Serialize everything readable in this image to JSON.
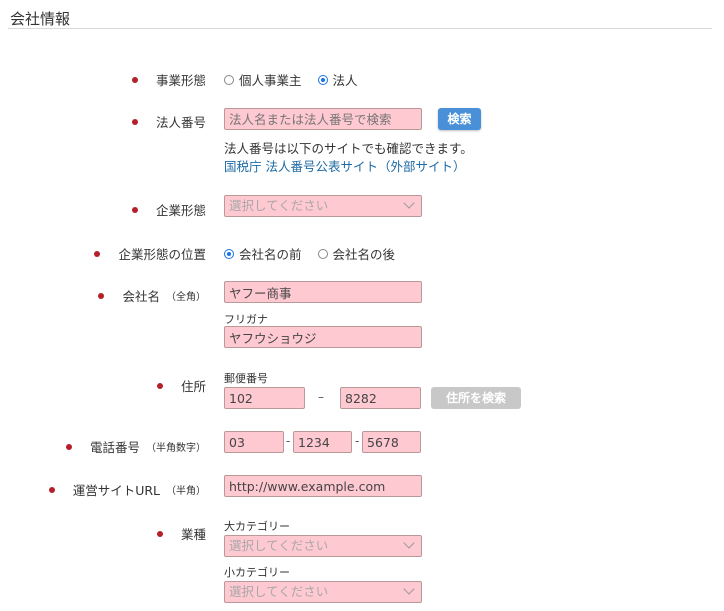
{
  "section_title": "会社情報",
  "business_type": {
    "label": "事業形態",
    "options": [
      "個人事業主",
      "法人"
    ],
    "selected": 1
  },
  "corporate_number": {
    "label": "法人番号",
    "placeholder": "法人名または法人番号で検索",
    "search_button": "検索",
    "help_text": "法人番号は以下のサイトでも確認できます。",
    "link_text": "国税庁 法人番号公表サイト（外部サイト）"
  },
  "company_form": {
    "label": "企業形態",
    "select_value": "選択してください"
  },
  "company_form_position": {
    "label": "企業形態の位置",
    "options": [
      "会社名の前",
      "会社名の後"
    ],
    "selected": 0
  },
  "company_name": {
    "label": "会社名",
    "label_note": "（全角）",
    "value": "ヤフー商事",
    "furigana_label": "フリガナ",
    "furigana_value": "ヤフウショウジ"
  },
  "address": {
    "label": "住所",
    "postal_label": "郵便番号",
    "postal_1": "102",
    "postal_sep": "–",
    "postal_2": "8282",
    "search_button": "住所を検索"
  },
  "phone": {
    "label": "電話番号",
    "label_note": "（半角数字）",
    "part1": "03",
    "part2": "1234",
    "part3": "5678",
    "sep": "-"
  },
  "site_url": {
    "label": "運営サイトURL",
    "label_note": "（半角）",
    "value": "http://www.example.com"
  },
  "industry": {
    "label": "業種",
    "major_label": "大カテゴリー",
    "major_value": "選択してください",
    "minor_label": "小カテゴリー",
    "minor_value": "選択してください"
  },
  "colors": {
    "required_dot": "#b51f2a",
    "input_bg": "#ffc9d2",
    "primary_button": "#4a90d9",
    "disabled_button": "#c8c8c8",
    "link": "#1d6aa6"
  }
}
